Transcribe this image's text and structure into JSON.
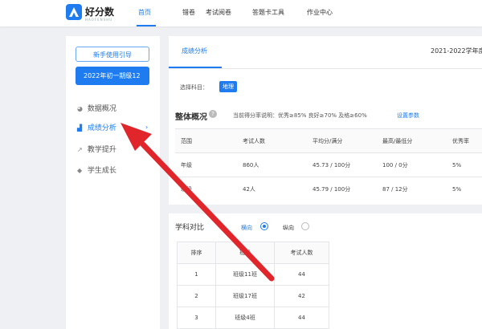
{
  "app": {
    "logo_text": "好分数",
    "logo_sub": "HAOFENSHU"
  },
  "nav": {
    "items": [
      "首页",
      "错卷",
      "考试阅卷",
      "答题卡工具",
      "作业中心"
    ],
    "active": "首页"
  },
  "sidebar": {
    "guide_button": "新手使用引导",
    "grade_select": "2022年初一期级12",
    "items": [
      {
        "icon": "pie-chart-icon",
        "label": "数据概况"
      },
      {
        "icon": "bar-chart-icon",
        "label": "成绩分析"
      },
      {
        "icon": "trend-icon",
        "label": "教学提升"
      },
      {
        "icon": "cap-icon",
        "label": "学生成长"
      }
    ],
    "active": "成绩分析"
  },
  "main": {
    "tab": "成绩分析",
    "year": "2021-2022学年度",
    "subject_label": "选择科目：",
    "subject": "地理",
    "overview_title": "整体概况",
    "overview_desc": "当前得分率说明：优秀≥85% 良好≥70% 及格≥60%",
    "overview_link": "设置参数",
    "table": {
      "headers": [
        "范围",
        "考试人数",
        "平均分/满分",
        "最高/最低分",
        "优秀率"
      ],
      "rows": [
        [
          "年级",
          "860人",
          "45.73 / 100分",
          "100 / 0分",
          "5%"
        ],
        [
          "班级",
          "42人",
          "45.79 / 100分",
          "87 / 12分",
          "5%"
        ]
      ]
    }
  },
  "compare": {
    "title": "学科对比",
    "radio_horizontal": "横向",
    "radio_vertical": "纵向",
    "selected": "横向",
    "table": {
      "headers": [
        "排序",
        "班级",
        "考试人数"
      ],
      "rows": [
        [
          "1",
          "班级11班",
          "44"
        ],
        [
          "2",
          "班级17班",
          "42"
        ],
        [
          "3",
          "班级4班",
          "44"
        ]
      ]
    }
  },
  "annotation": {
    "arrow_color": "#e0262b"
  }
}
